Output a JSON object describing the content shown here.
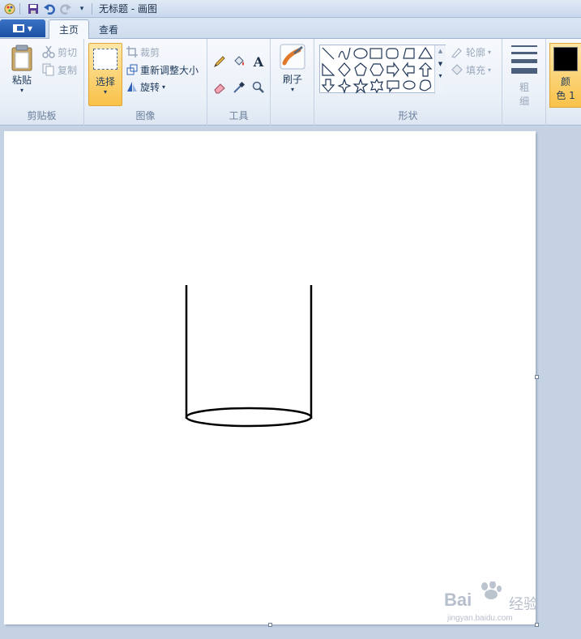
{
  "window": {
    "title": "无标题 - 画图"
  },
  "tabs": [
    {
      "label": "主页",
      "active": true
    },
    {
      "label": "查看",
      "active": false
    }
  ],
  "clipboard": {
    "paste": "粘贴",
    "cut": "剪切",
    "copy": "复制",
    "group_label": "剪贴板"
  },
  "image": {
    "select": "选择",
    "crop": "裁剪",
    "resize": "重新调整大小",
    "rotate": "旋转",
    "group_label": "图像"
  },
  "tools": {
    "group_label": "工具",
    "items": [
      "pencil-icon",
      "fill-icon",
      "text-icon",
      "eraser-icon",
      "color-picker-icon",
      "magnifier-icon"
    ]
  },
  "brushes": {
    "label": "刷子"
  },
  "shapes": {
    "group_label": "形状",
    "outline": "轮廓",
    "fill": "填充"
  },
  "size": {
    "label_line1": "粗",
    "label_line2": "细"
  },
  "colors": {
    "color1_line1": "颜",
    "color1_line2": "色 1",
    "color1_value": "#000000",
    "accent": "#f9c24a"
  },
  "watermark": {
    "brand": "Bai",
    "brand_cn": "经验",
    "url": "jingyan.baidu.com"
  }
}
